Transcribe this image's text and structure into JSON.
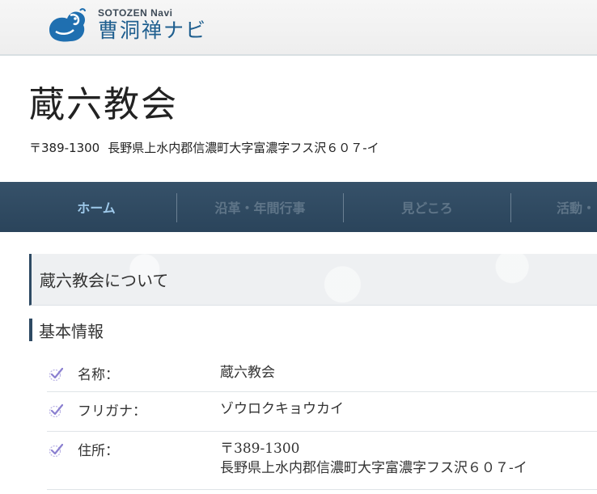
{
  "header": {
    "logo_sub": "SOTOZEN Navi",
    "logo_main": "曹洞禅ナビ"
  },
  "temple": {
    "name": "蔵六教会",
    "postal": "〒389-1300",
    "address": "長野県上水内郡信濃町大字富濃字フス沢６０７-イ"
  },
  "nav": {
    "items": [
      {
        "label": "ホーム",
        "active": true
      },
      {
        "label": "沿革・年間行事",
        "active": false
      },
      {
        "label": "見どころ",
        "active": false
      },
      {
        "label": "活動・",
        "active": false
      }
    ]
  },
  "section": {
    "title": "蔵六教会について",
    "sub_title": "基本情報"
  },
  "info": {
    "rows": [
      {
        "label": "名称：",
        "value": "蔵六教会"
      },
      {
        "label": "フリガナ：",
        "value": "ゾウロクキョウカイ"
      },
      {
        "label": "住所：",
        "value_line1": "〒389-1300",
        "value_line2": "長野県上水内郡信濃町大字富濃字フス沢６０７-イ"
      }
    ]
  },
  "colors": {
    "nav_bg": "#2e4a63",
    "nav_active": "#9ec9ea",
    "nav_inactive": "#5f7588",
    "logo_blue": "#1f5f8f",
    "check_purple": "#8a7fd0"
  },
  "icons": {
    "logo": "sotozen-logo-icon",
    "check": "check-icon"
  }
}
